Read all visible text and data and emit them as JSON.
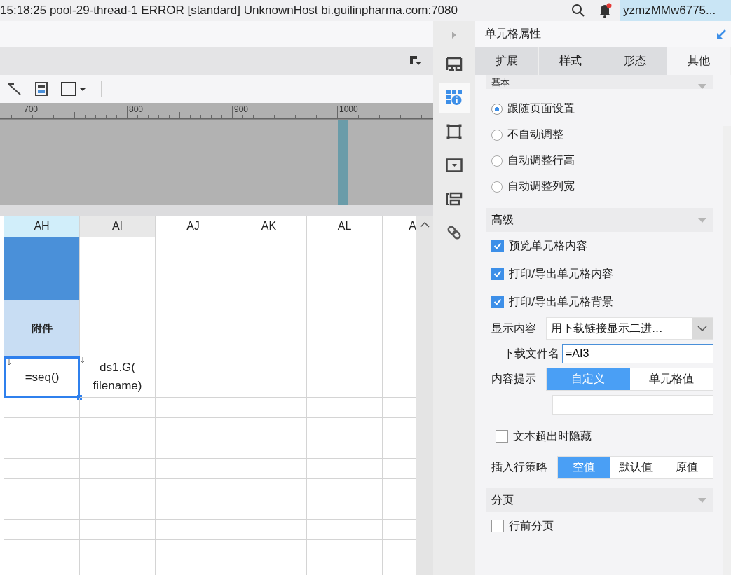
{
  "status_bar": {
    "message": "15:18:25 pool-29-thread-1 ERROR [standard] UnknownHost bi.guilinpharma.com:7080",
    "user": "yzmzMMw6775..."
  },
  "ruler": {
    "labels": [
      "700",
      "800",
      "900",
      "1000"
    ]
  },
  "sheet": {
    "columns": [
      {
        "label": "AH",
        "selected": true,
        "shaded": false
      },
      {
        "label": "AI",
        "selected": false,
        "shaded": true
      },
      {
        "label": "AJ",
        "selected": false,
        "shaded": false
      },
      {
        "label": "AK",
        "selected": false,
        "shaded": false
      },
      {
        "label": "AL",
        "selected": false,
        "shaded": false
      },
      {
        "label": "A",
        "selected": false,
        "shaded": false
      }
    ],
    "rows": [
      {
        "cells": [
          {
            "kind": "dark"
          },
          {
            "kind": "blank"
          },
          {
            "kind": "blank"
          },
          {
            "kind": "blank"
          },
          {
            "kind": "blank"
          },
          {
            "kind": "blank"
          }
        ]
      },
      {
        "cells": [
          {
            "kind": "title",
            "text": "附件"
          },
          {
            "kind": "blank"
          },
          {
            "kind": "blank"
          },
          {
            "kind": "blank"
          },
          {
            "kind": "blank"
          },
          {
            "kind": "blank"
          }
        ]
      },
      {
        "cells": [
          {
            "kind": "editing",
            "text": "=seq()",
            "expand": true
          },
          {
            "kind": "plain",
            "text": "ds1.G( filename)",
            "expand": true
          },
          {
            "kind": "blank"
          },
          {
            "kind": "blank"
          },
          {
            "kind": "blank"
          },
          {
            "kind": "blank"
          }
        ]
      }
    ]
  },
  "icon_bar": [
    {
      "kind": "layout",
      "selected": false
    },
    {
      "kind": "cell-info",
      "selected": true
    },
    {
      "kind": "border",
      "selected": false
    },
    {
      "kind": "widget",
      "selected": false
    },
    {
      "kind": "condition",
      "selected": false
    },
    {
      "kind": "link",
      "selected": false
    }
  ],
  "panel": {
    "title": "单元格属性",
    "tabs": [
      {
        "label": "扩展",
        "selected": false
      },
      {
        "label": "样式",
        "selected": false
      },
      {
        "label": "形态",
        "selected": false
      },
      {
        "label": "其他",
        "selected": true
      }
    ],
    "sections": [
      {
        "title": "基本",
        "expanded": true,
        "items": [
          {
            "kind": "radio",
            "label": "跟随页面设置",
            "selected": true
          },
          {
            "kind": "radio",
            "label": "不自动调整",
            "selected": false
          },
          {
            "kind": "radio",
            "label": "自动调整行高",
            "selected": false
          },
          {
            "kind": "radio",
            "label": "自动调整列宽",
            "selected": false
          }
        ]
      },
      {
        "title": "高级",
        "expanded": true,
        "items": [
          {
            "kind": "checkbox",
            "label": "预览单元格内容",
            "checked": true
          },
          {
            "kind": "checkbox",
            "label": "打印/导出单元格内容",
            "checked": true
          },
          {
            "kind": "checkbox",
            "label": "打印/导出单元格背景",
            "checked": true
          },
          {
            "kind": "select",
            "label": "显示内容",
            "value": "用下载链接显示二进..."
          },
          {
            "kind": "field",
            "label": "下载文件名",
            "value": "=AI3"
          },
          {
            "kind": "segmented",
            "label": "内容提示",
            "options": [
              {
                "label": "自定义",
                "selected": true
              },
              {
                "label": "单元格值",
                "selected": false
              }
            ]
          },
          {
            "kind": "input"
          },
          {
            "kind": "checkbox",
            "label": "文本超出时隐藏",
            "checked": false
          },
          {
            "kind": "segmented",
            "label": "插入行策略",
            "options": [
              {
                "label": "空值",
                "selected": true
              },
              {
                "label": "默认值",
                "selected": false
              },
              {
                "label": "原值",
                "selected": false
              }
            ]
          }
        ]
      },
      {
        "title": "分页",
        "expanded": true,
        "items": [
          {
            "kind": "checkbox",
            "label": "行前分页",
            "checked": false
          }
        ]
      }
    ]
  }
}
